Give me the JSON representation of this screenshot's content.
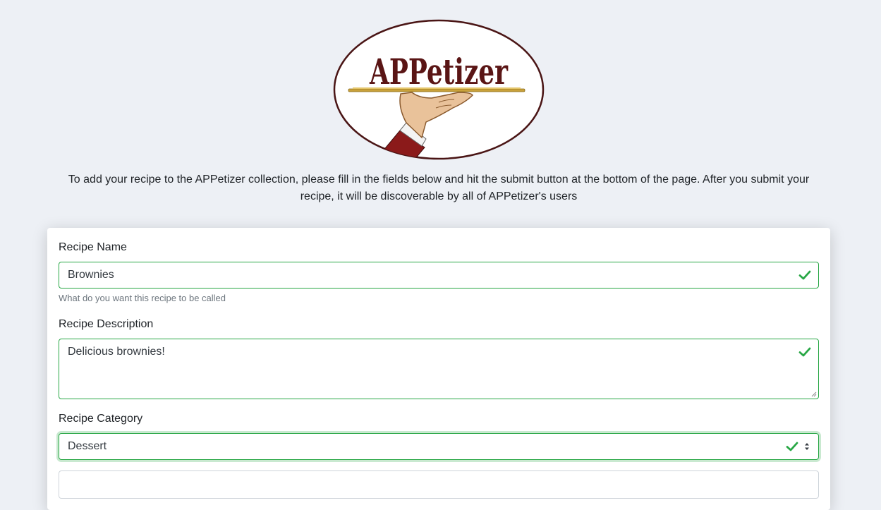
{
  "brand": {
    "logo_text": "APPetizer",
    "colors": {
      "logo_text": "#5a1515",
      "logo_border": "#4a1515",
      "tray": "#c9a13a",
      "skin": "#e9c29a",
      "sleeve": "#8b1a1a"
    }
  },
  "intro": {
    "text": "To add your recipe to the APPetizer collection, please fill in the fields below and hit the submit button at the bottom of the page. After you submit your recipe, it will be discoverable by all of APPetizer's users"
  },
  "form": {
    "recipe_name": {
      "label": "Recipe Name",
      "value": "Brownies",
      "help": "What do you want this recipe to be called",
      "valid": true
    },
    "recipe_description": {
      "label": "Recipe Description",
      "value": "Delicious brownies!",
      "valid": true
    },
    "recipe_category": {
      "label": "Recipe Category",
      "value": "Dessert",
      "valid": true
    }
  },
  "icons": {
    "valid": "checkmark-icon",
    "select": "updown-caret-icon",
    "resize": "resize-handle-icon"
  },
  "colors": {
    "valid": "#28a745",
    "background": "#edf0f5",
    "card": "#ffffff",
    "help_text": "#6c757d"
  }
}
